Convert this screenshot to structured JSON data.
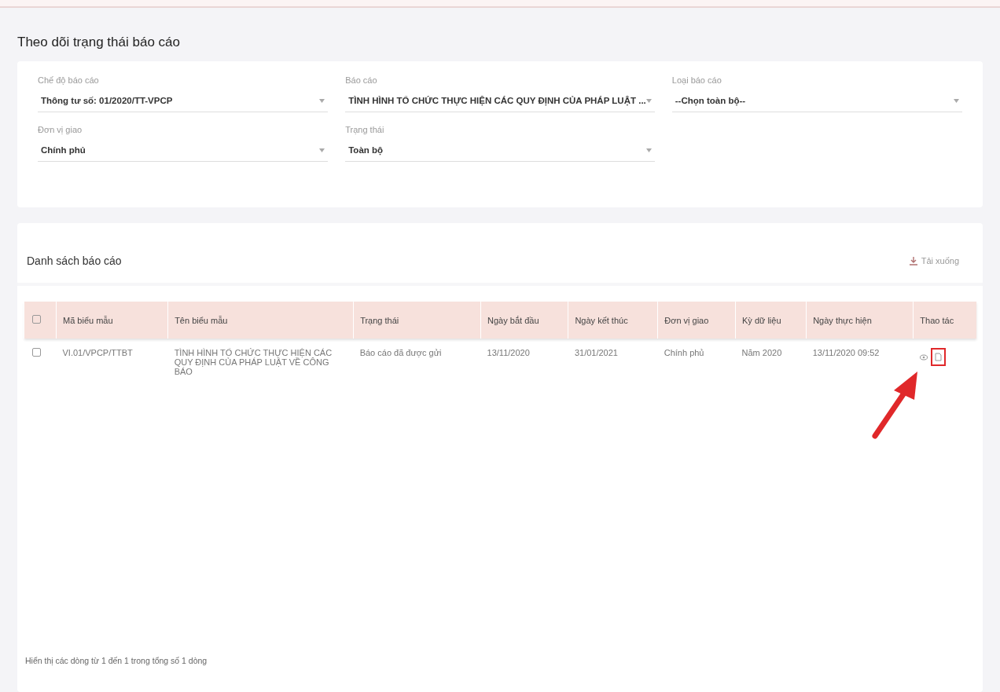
{
  "page_title": "Theo dõi trạng thái báo cáo",
  "filters": [
    {
      "label": "Chế độ báo cáo",
      "value": "Thông tư số: 01/2020/TT-VPCP"
    },
    {
      "label": "Báo cáo",
      "value": "TÌNH HÌNH TỔ CHỨC THỰC HIỆN CÁC QUY ĐỊNH CỦA PHÁP LUẬT ..."
    },
    {
      "label": "Loại báo cáo",
      "value": "--Chọn toàn bộ--"
    },
    {
      "label": "Đơn vị giao",
      "value": "Chính phủ"
    },
    {
      "label": "Trạng thái",
      "value": "Toàn bộ"
    }
  ],
  "list": {
    "title": "Danh sách báo cáo",
    "download": "Tải xuống",
    "select_all": {
      "checked": false
    },
    "columns": [
      "Mã biểu mẫu",
      "Tên biểu mẫu",
      "Trạng thái",
      "Ngày bắt đầu",
      "Ngày kết thúc",
      "Đơn vị giao",
      "Kỳ dữ liệu",
      "Ngày thực hiện",
      "Thao tác"
    ],
    "rows": [
      {
        "checked": false,
        "cells": [
          "VI.01/VPCP/TTBT",
          "TÌNH HÌNH TỔ CHỨC THỰC HIỆN CÁC QUY ĐỊNH CỦA PHÁP LUẬT VỀ CÔNG BÁO",
          "Báo cáo đã được gửi",
          "13/11/2020",
          "31/01/2021",
          "Chính phủ",
          "Năm 2020",
          "13/11/2020 09:52"
        ]
      }
    ],
    "footer": "Hiển thị các dòng từ 1 đến 1 trong tổng số 1 dòng"
  }
}
